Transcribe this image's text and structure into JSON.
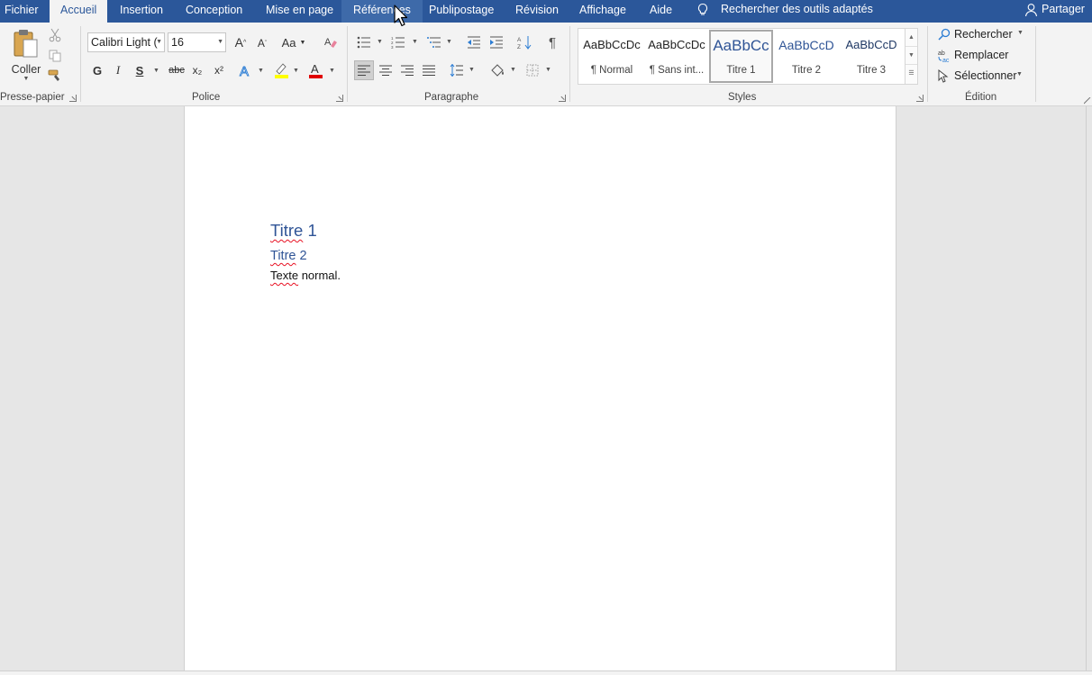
{
  "tabs": [
    {
      "id": "fichier",
      "label": "Fichier"
    },
    {
      "id": "accueil",
      "label": "Accueil",
      "active": true
    },
    {
      "id": "insertion",
      "label": "Insertion"
    },
    {
      "id": "conception",
      "label": "Conception"
    },
    {
      "id": "mise-en-page",
      "label": "Mise en page"
    },
    {
      "id": "references",
      "label": "Références",
      "hover": true
    },
    {
      "id": "publipostage",
      "label": "Publipostage"
    },
    {
      "id": "revision",
      "label": "Révision"
    },
    {
      "id": "affichage",
      "label": "Affichage"
    },
    {
      "id": "aide",
      "label": "Aide"
    }
  ],
  "search_tools": {
    "label": "Rechercher des outils adaptés",
    "icon": "lightbulb-icon"
  },
  "share": {
    "label": "Partager",
    "icon": "person-icon"
  },
  "colors": {
    "accent": "#2b579a",
    "heading": "#2f5496",
    "ribbon": "#f3f3f3",
    "spelling": "#e81123",
    "font_color": "#e00000",
    "highlight": "#ffff00"
  },
  "ribbon": {
    "clipboard": {
      "label": "Presse-papiers",
      "paste_label": "Coller"
    },
    "font": {
      "label": "Police",
      "font_name": "Calibri Light (",
      "font_size": "16",
      "bold": "G",
      "italic": "I",
      "underline": "S",
      "strike": "abc",
      "subscript": "x₂",
      "superscript": "x²",
      "grow": "A",
      "shrink": "A",
      "case": "Aa"
    },
    "paragraph": {
      "label": "Paragraphe"
    },
    "styles": {
      "label": "Styles",
      "items": [
        {
          "sample": "AaBbCcDc",
          "name": "¶ Normal"
        },
        {
          "sample": "AaBbCcDc",
          "name": "¶ Sans int..."
        },
        {
          "sample": "AaBbCc",
          "name": "Titre 1",
          "selected": true
        },
        {
          "sample": "AaBbCcD",
          "name": "Titre 2"
        },
        {
          "sample": "AaBbCcD",
          "name": "Titre 3"
        }
      ]
    },
    "editing": {
      "label": "Édition",
      "find": "Rechercher",
      "replace": "Remplacer",
      "select": "Sélectionner"
    }
  },
  "document": {
    "heading1": {
      "first": "Titre",
      "rest": " 1"
    },
    "heading2": {
      "first": "Titre",
      "rest": " 2"
    },
    "body": {
      "first": "Texte",
      "rest": " normal."
    }
  }
}
